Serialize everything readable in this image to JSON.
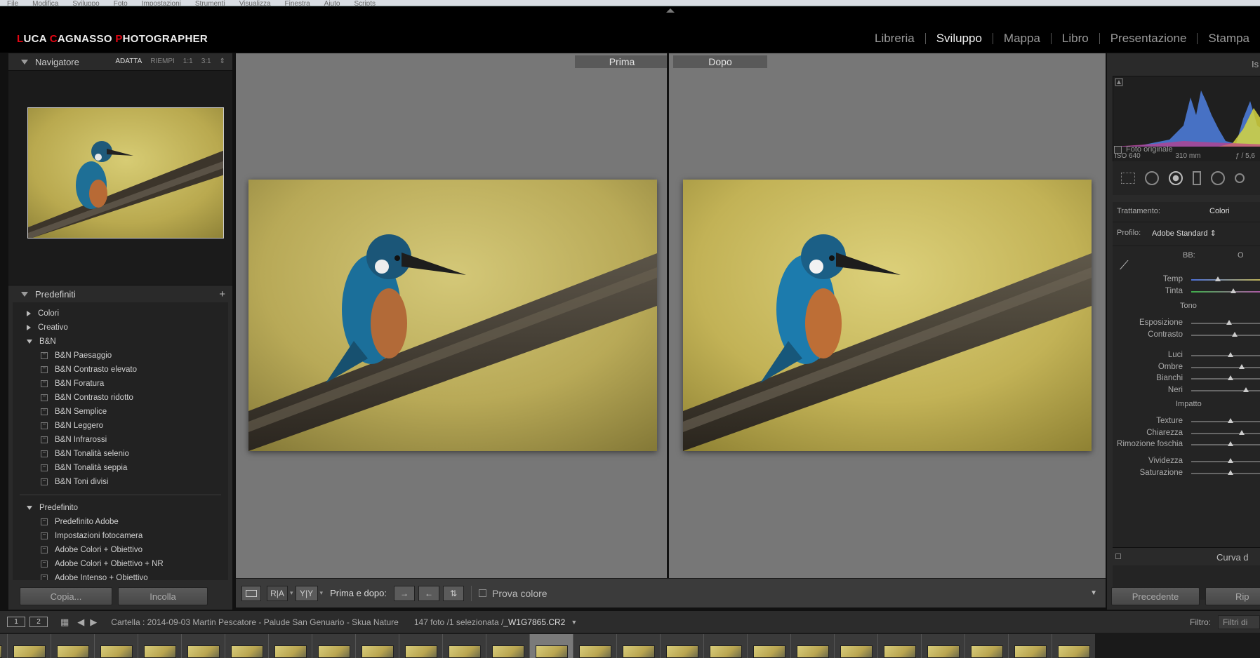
{
  "os_menu": [
    "File",
    "Modifica",
    "Sviluppo",
    "Foto",
    "Impostazioni",
    "Strumenti",
    "Visualizza",
    "Finestra",
    "Aiuto",
    "Scripts"
  ],
  "identity": {
    "parts": [
      {
        "initial": "L",
        "rest": "UCA "
      },
      {
        "initial": "C",
        "rest": "AGNASSO "
      },
      {
        "initial": "P",
        "rest": "HOTOGRAPHER"
      }
    ]
  },
  "modules": [
    {
      "label": "Libreria",
      "active": false
    },
    {
      "label": "Sviluppo",
      "active": true
    },
    {
      "label": "Mappa",
      "active": false
    },
    {
      "label": "Libro",
      "active": false
    },
    {
      "label": "Presentazione",
      "active": false
    },
    {
      "label": "Stampa",
      "active": false
    }
  ],
  "navigator": {
    "title": "Navigatore",
    "modes": [
      "ADATTA",
      "RIEMPI",
      "1:1",
      "3:1"
    ]
  },
  "presets": {
    "title": "Predefiniti",
    "folders": [
      {
        "label": "Colori",
        "open": false,
        "items": []
      },
      {
        "label": "Creativo",
        "open": false,
        "items": []
      },
      {
        "label": "B&N",
        "open": true,
        "items": [
          "B&N Paesaggio",
          "B&N Contrasto elevato",
          "B&N Foratura",
          "B&N Contrasto ridotto",
          "B&N Semplice",
          "B&N Leggero",
          "B&N Infrarossi",
          "B&N Tonalità selenio",
          "B&N Tonalità seppia",
          "B&N Toni divisi"
        ]
      },
      {
        "label": "Predefinito",
        "open": true,
        "items": [
          "Predefinito Adobe",
          "Impostazioni fotocamera",
          "Adobe Colori + Obiettivo",
          "Adobe Colori + Obiettivo + NR",
          "Adobe Intenso + Obiettivo"
        ]
      }
    ]
  },
  "left_buttons": {
    "copy": "Copia...",
    "paste": "Incolla"
  },
  "views": {
    "before": "Prima",
    "after": "Dopo"
  },
  "toolbar": {
    "btn_ra": "R|A",
    "btn_yy": "Y|Y",
    "before_after": "Prima e dopo:",
    "proof": "Prova colore"
  },
  "histogram": {
    "iso": "ISO 640",
    "focal": "310 mm",
    "aperture": "ƒ / 5,6",
    "original": "Foto originale"
  },
  "basic": {
    "treatment_label": "Trattamento:",
    "treatment_value": "Colori",
    "profile_label": "Profilo:",
    "profile_value": "Adobe Standard",
    "wb_label": "BB:",
    "wb_value": "O",
    "tone_title": "Tono",
    "presence_title": "Impatto",
    "sliders": [
      {
        "label": "Temp",
        "value": 0.32
      },
      {
        "label": "Tinta",
        "value": 0.5
      },
      {
        "label": "Esposizione",
        "value": 0.45
      },
      {
        "label": "Contrasto",
        "value": 0.52
      },
      {
        "label": "Luci",
        "value": 0.47
      },
      {
        "label": "Ombre",
        "value": 0.6
      },
      {
        "label": "Bianchi",
        "value": 0.47
      },
      {
        "label": "Neri",
        "value": 0.65
      },
      {
        "label": "Texture",
        "value": 0.47
      },
      {
        "label": "Chiarezza",
        "value": 0.6
      },
      {
        "label": "Rimozione foschia",
        "value": 0.47
      },
      {
        "label": "Vividezza",
        "value": 0.47
      },
      {
        "label": "Saturazione",
        "value": 0.47
      }
    ],
    "curve": "Curva d",
    "prev_button": "Precedente",
    "reset_button": "Rip"
  },
  "filmbar": {
    "screen1": "1",
    "screen2": "2",
    "folder": "Cartella : 2014-09-03 Martin Pescatore - Palude San Genuario - Skua Nature",
    "count": "147 foto /1 selezionata /",
    "filename": "_W1G7865.CR2",
    "filter_label": "Filtro:",
    "filter_value": "Filtri di"
  }
}
